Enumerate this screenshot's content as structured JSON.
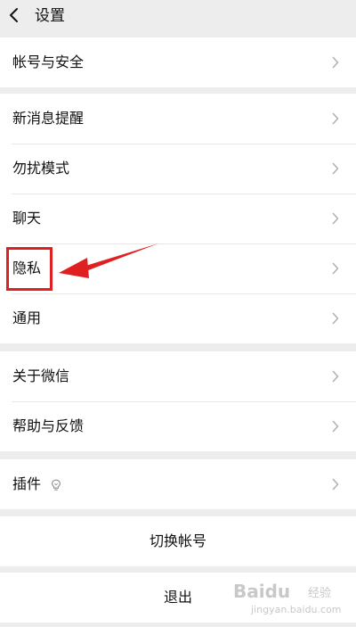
{
  "header": {
    "title": "设置",
    "back_icon": "chevron-left-icon"
  },
  "groups": {
    "account": {
      "items": [
        {
          "label": "帐号与安全"
        }
      ]
    },
    "settings": {
      "items": [
        {
          "label": "新消息提醒"
        },
        {
          "label": "勿扰模式"
        },
        {
          "label": "聊天"
        },
        {
          "label": "隐私"
        },
        {
          "label": "通用"
        }
      ]
    },
    "about": {
      "items": [
        {
          "label": "关于微信"
        },
        {
          "label": "帮助与反馈"
        }
      ]
    },
    "plugins": {
      "items": [
        {
          "label": "插件",
          "icon": "lightbulb-icon"
        }
      ]
    }
  },
  "buttons": {
    "switch_account": "切换帐号",
    "logout": "退出"
  },
  "annotation": {
    "highlighted_item": "隐私",
    "color": "#e02020"
  },
  "watermark": {
    "logo": "Baidu",
    "sub": "经验",
    "url": "jingyan.baidu.com"
  }
}
